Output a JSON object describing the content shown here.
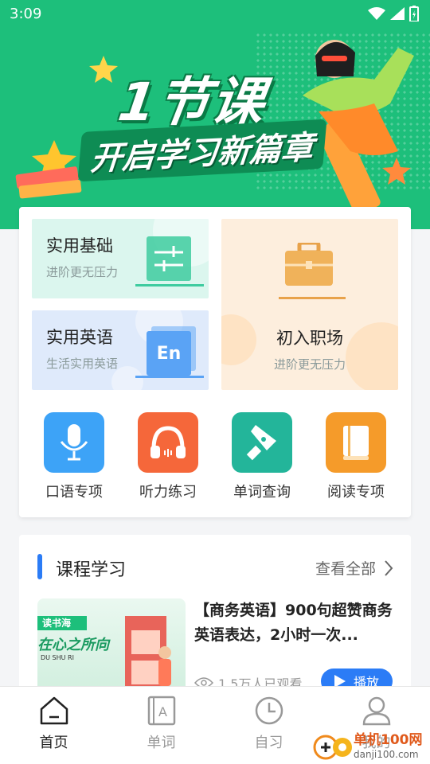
{
  "status_bar": {
    "time": "3:09"
  },
  "banner": {
    "title": "1节课",
    "subtitle": "开启学习新篇章"
  },
  "categories": [
    {
      "title": "实用基础",
      "subtitle": "进阶更无压力"
    },
    {
      "title": "实用英语",
      "subtitle": "生活实用英语",
      "icon_text": "En"
    },
    {
      "title": "初入职场",
      "subtitle": "进阶更无压力"
    }
  ],
  "quick_entries": [
    {
      "label": "口语专项",
      "icon": "microphone-icon",
      "color": "#3da3f7"
    },
    {
      "label": "听力练习",
      "icon": "headphones-icon",
      "color": "#f5673a"
    },
    {
      "label": "单词查询",
      "icon": "pen-nib-icon",
      "color": "#23b59a"
    },
    {
      "label": "阅读专项",
      "icon": "book-icon",
      "color": "#f59b2a"
    }
  ],
  "course_section": {
    "title": "课程学习",
    "view_all": "查看全部",
    "item": {
      "title": "【商务英语】900句超赞商务英语表达，2小时一次...",
      "views": "1.5万人已观看",
      "play_label": "播放",
      "thumb_text_top": "读书海",
      "thumb_text_main": "在心之所向",
      "thumb_text_small": "DU SHU RI"
    }
  },
  "tabs": [
    {
      "label": "首页",
      "icon": "home-icon",
      "active": true
    },
    {
      "label": "单词",
      "icon": "word-card-icon",
      "active": false
    },
    {
      "label": "自习",
      "icon": "clock-icon",
      "active": false
    },
    {
      "label": "我的",
      "icon": "user-icon",
      "active": false
    }
  ],
  "watermark": {
    "line1": "单机100网",
    "line2": "danji100.com"
  }
}
